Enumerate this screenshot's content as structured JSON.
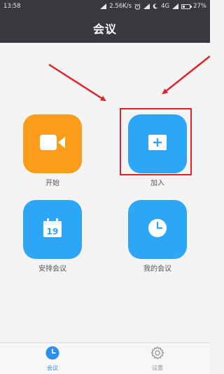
{
  "status_bar": {
    "time": "13:58",
    "network_speed": "2.56K/s",
    "network_type": "4G",
    "battery": "27%",
    "battery_level": 0.27,
    "icons": [
      "alarm-icon",
      "signal-icon",
      "moon-icon",
      "signal-icon",
      "battery-icon"
    ]
  },
  "header": {
    "title": "会议"
  },
  "grid": {
    "items": [
      {
        "label": "开始",
        "icon": "video-camera-icon",
        "color": "#fb9d1a"
      },
      {
        "label": "加入",
        "icon": "plus-icon",
        "color": "#2ea6f7"
      },
      {
        "label": "安排会议",
        "icon": "calendar-icon",
        "color": "#2ea6f7",
        "calendar_day": "19"
      },
      {
        "label": "我的会议",
        "icon": "clock-icon",
        "color": "#2ea6f7"
      }
    ]
  },
  "annotation": {
    "highlight_color": "#e0242b"
  },
  "bottom_nav": {
    "items": [
      {
        "label": "会议",
        "icon": "clock-icon",
        "active": true
      },
      {
        "label": "设置",
        "icon": "gear-icon",
        "active": false
      }
    ],
    "active_color": "#2e90e8"
  }
}
